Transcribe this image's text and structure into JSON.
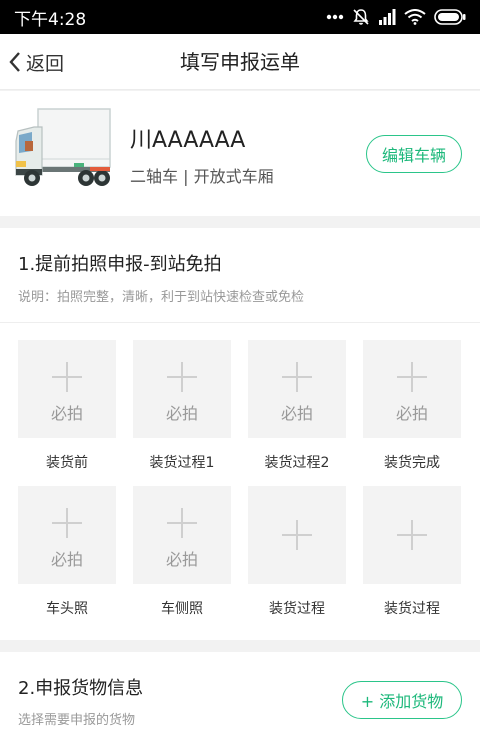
{
  "status_bar": {
    "time": "下午4:28"
  },
  "nav": {
    "back_label": "返回",
    "title": "填写申报运单"
  },
  "vehicle": {
    "plate": "川AAAAAA",
    "description": "二轴车 | 开放式车厢",
    "edit_label": "编辑车辆"
  },
  "photo_section": {
    "title": "1.提前拍照申报-到站免拍",
    "note": "说明：拍照完整，清晰，利于到站快速检查或免检",
    "items": [
      {
        "label": "装货前",
        "required": "必拍"
      },
      {
        "label": "装货过程1",
        "required": "必拍"
      },
      {
        "label": "装货过程2",
        "required": "必拍"
      },
      {
        "label": "装货完成",
        "required": "必拍"
      },
      {
        "label": "车头照",
        "required": "必拍"
      },
      {
        "label": "车侧照",
        "required": "必拍"
      },
      {
        "label": "装货过程",
        "required": ""
      },
      {
        "label": "装货过程",
        "required": ""
      }
    ]
  },
  "cargo_section": {
    "title": "2.申报货物信息",
    "note": "选择需要申报的货物",
    "add_label": "+ 添加货物"
  },
  "colors": {
    "accent": "#1db87b",
    "background": "#f2f2f2"
  }
}
